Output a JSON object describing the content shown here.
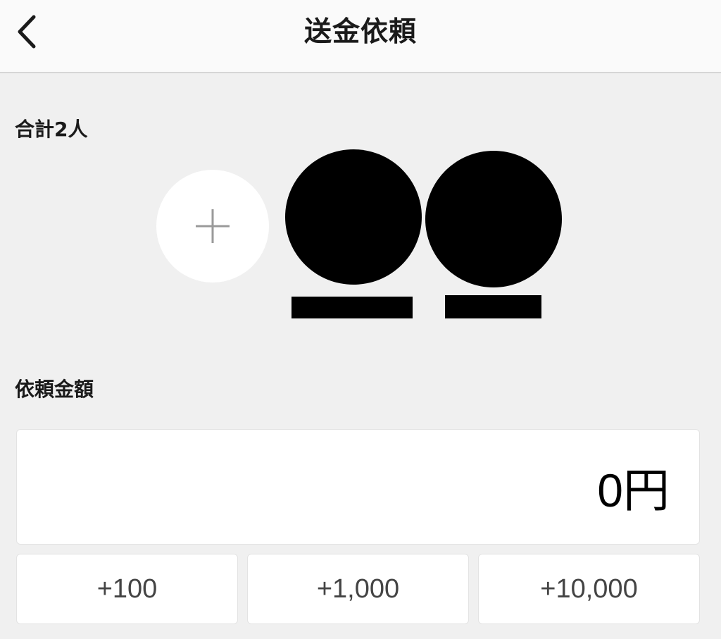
{
  "header": {
    "back_icon": "chevron-left-icon",
    "title": "送金依頼"
  },
  "members": {
    "label": "合計2人",
    "add_icon": "plus-icon",
    "count": 2
  },
  "amount": {
    "label": "依頼金額",
    "value": "0円"
  },
  "quick_add": [
    {
      "label": "+100"
    },
    {
      "label": "+1,000"
    },
    {
      "label": "+10,000"
    }
  ]
}
